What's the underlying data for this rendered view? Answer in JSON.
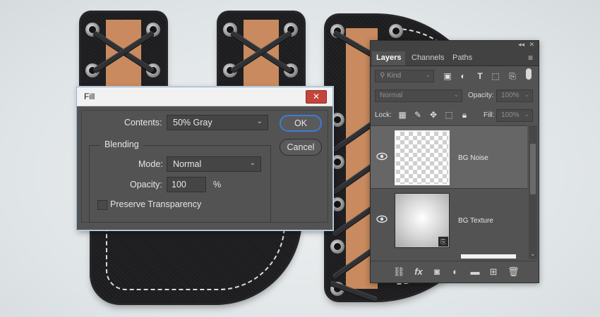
{
  "fill_dialog": {
    "title": "Fill",
    "close_glyph": "✕",
    "contents_label": "Contents:",
    "contents_value": "50% Gray",
    "ok_label": "OK",
    "cancel_label": "Cancel",
    "blending_label": "Blending",
    "mode_label": "Mode:",
    "mode_value": "Normal",
    "opacity_label": "Opacity:",
    "opacity_value": "100",
    "opacity_unit": "%",
    "preserve_label": "Preserve Transparency",
    "preserve_checked": false
  },
  "layers_panel": {
    "tabs": [
      "Layers",
      "Channels",
      "Paths"
    ],
    "kind_placeholder": "Kind",
    "blend_mode": "Normal",
    "opacity_label": "Opacity:",
    "opacity_value": "100%",
    "lock_label": "Lock:",
    "fill_label": "Fill:",
    "fill_value": "100%",
    "layers": [
      {
        "name": "BG Noise",
        "selected": true,
        "visible": true
      },
      {
        "name": "BG Texture",
        "selected": false,
        "visible": true
      }
    ],
    "filter_icons": [
      "image-filter-icon",
      "adjustment-filter-icon",
      "type-filter-icon",
      "shape-filter-icon",
      "smart-object-filter-icon"
    ],
    "bottom_icons": [
      "link-icon",
      "fx-icon",
      "mask-icon",
      "adjustment-icon",
      "folder-icon",
      "new-layer-icon",
      "trash-icon"
    ],
    "fx_label": "fx"
  },
  "colors": {
    "panel_bg": "#535353",
    "dialog_border": "#9bb3cc",
    "ok_focus": "#3e7bd6",
    "close_red": "#c4453a",
    "lace_tan": "#c88a5e"
  }
}
